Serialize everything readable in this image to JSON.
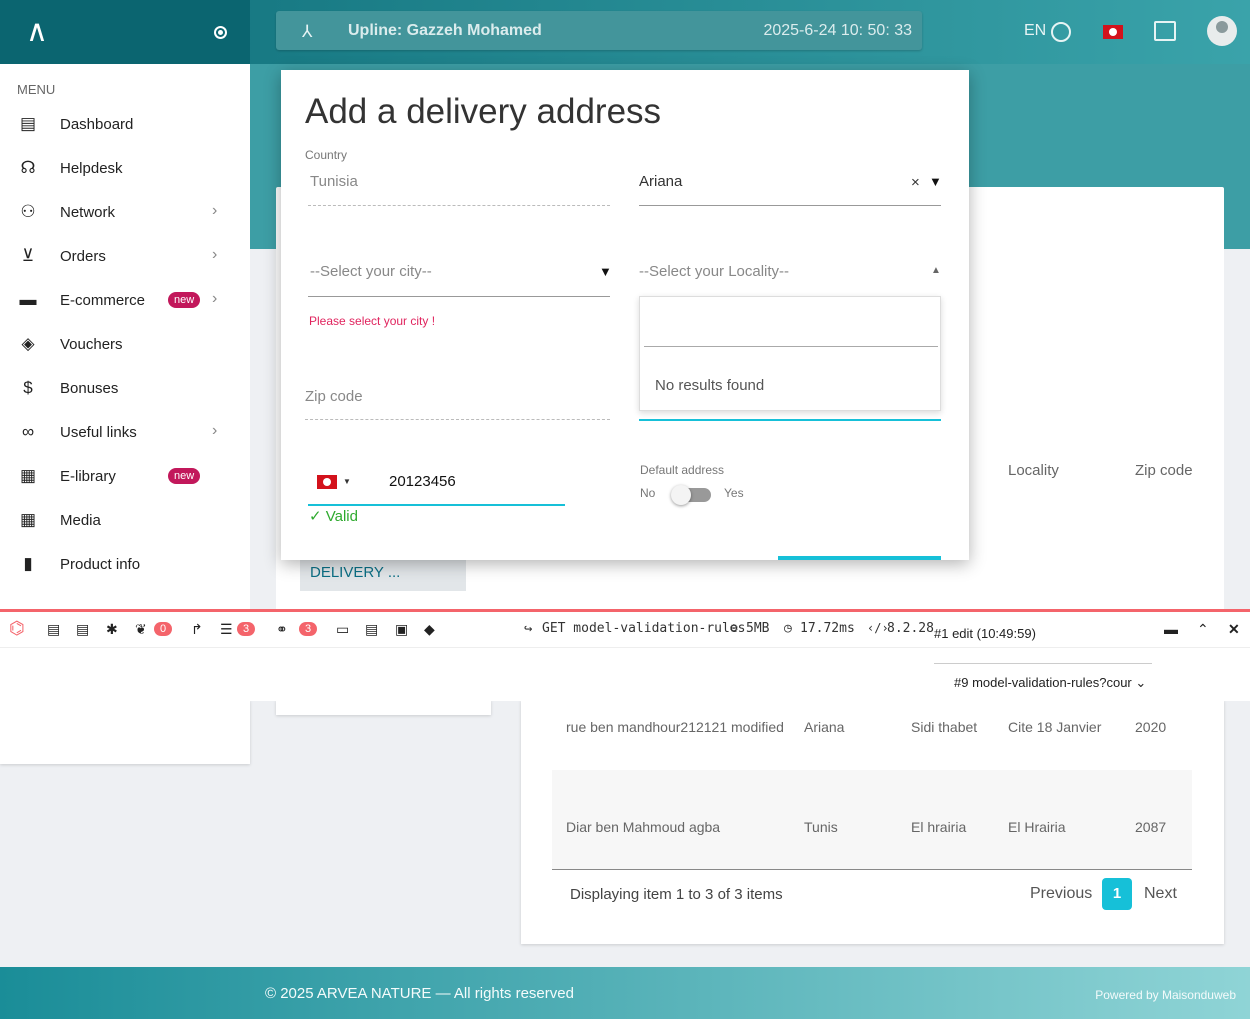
{
  "header": {
    "upline": "Upline: Gazzeh Mohamed",
    "datetime": "2025-6-24 10: 50: 33",
    "lang": "EN"
  },
  "sidebar": {
    "menu_heading": "MENU",
    "items": [
      {
        "label": "Dashboard",
        "icon": "dashboard-icon"
      },
      {
        "label": "Helpdesk",
        "icon": "headset-icon"
      },
      {
        "label": "Network",
        "icon": "people-icon"
      },
      {
        "label": "Orders",
        "icon": "cart-icon"
      },
      {
        "label": "E-commerce",
        "icon": "store-icon",
        "badge": "new"
      },
      {
        "label": "Vouchers",
        "icon": "voucher-icon"
      },
      {
        "label": "Bonuses",
        "icon": "dollar-icon"
      },
      {
        "label": "Useful links",
        "icon": "infinity-icon"
      },
      {
        "label": "E-library",
        "icon": "library-icon",
        "badge": "new"
      },
      {
        "label": "Media",
        "icon": "media-icon"
      },
      {
        "label": "Product info",
        "icon": "bar-chart-icon"
      }
    ]
  },
  "background": {
    "delivery_tab": "DELIVERY ...",
    "table_headers": {
      "locality": "Locality",
      "zip": "Zip code"
    },
    "rows": [
      {
        "address": "rue ben mandhour212121 modified",
        "state": "Ariana",
        "city": "Sidi thabet",
        "locality": "Cite 18 Janvier",
        "zip": "2020"
      },
      {
        "address": "Diar ben Mahmoud agba",
        "state": "Tunis",
        "city": "El hrairia",
        "locality": "El Hrairia",
        "zip": "2087"
      }
    ],
    "pager": {
      "summary": "Displaying item 1 to 3 of 3 items",
      "prev": "Previous",
      "page": "1",
      "next": "Next"
    }
  },
  "modal": {
    "title": "Add a delivery address",
    "country_label": "Country",
    "country_value": "Tunisia",
    "state_value": "Ariana",
    "clear_symbol": "×",
    "city_placeholder": "--Select your city--",
    "city_error": "Please select your city !",
    "locality_placeholder": "--Select your Locality--",
    "dropdown_empty": "No results found",
    "zip_placeholder": "Zip code",
    "phone_value": "20123456",
    "phone_valid": "✓ Valid",
    "default_label": "Default address",
    "toggle_no": "No",
    "toggle_yes": "Yes"
  },
  "debugbar": {
    "badge_logs": "0",
    "badge_queries": "3",
    "badge_models": "3",
    "request": "GET model-validation-rules",
    "memory": "5MB",
    "duration": "17.72ms",
    "php": "8.2.28",
    "history": "#1 edit (10:49:59)",
    "selected": "#9 model-validation-rules?cour"
  },
  "footer": {
    "copyright": "© 2025 ARVEA NATURE — All rights reserved",
    "powered": "Powered by Maisonduweb"
  },
  "colors": {
    "accent": "#16c0d8",
    "header": "#0f6f7a",
    "debug_red": "#f4646b",
    "badge_new": "#c2185b"
  }
}
